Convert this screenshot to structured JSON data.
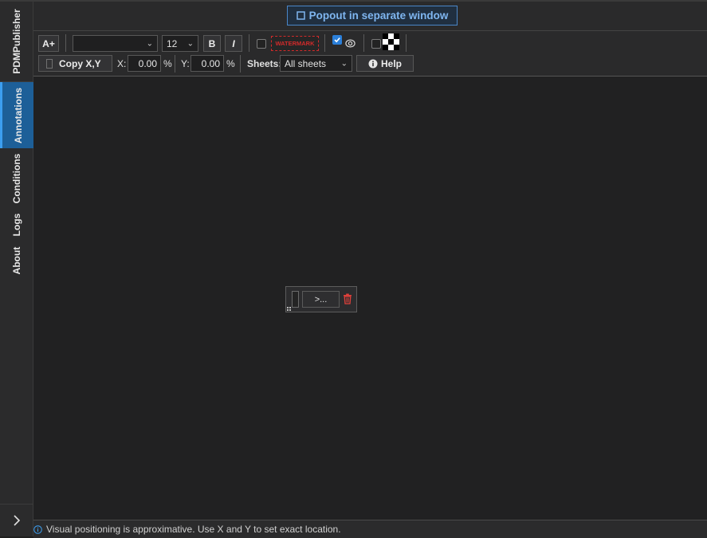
{
  "sidebar": {
    "tabs": [
      {
        "label": "PDMPublisher",
        "active": false
      },
      {
        "label": "Annotations",
        "active": true
      },
      {
        "label": "Conditions",
        "active": false
      },
      {
        "label": "Logs",
        "active": false
      },
      {
        "label": "About",
        "active": false
      }
    ],
    "expand_icon": "chevron-right-icon"
  },
  "toolbar": {
    "popout_label": "Popout in separate window",
    "add_text_label": "A+",
    "font_family_value": "",
    "font_size_value": "12",
    "bold_label": "B",
    "italic_label": "I",
    "watermark_label": "WATERMARK",
    "watermark_checked": false,
    "visible_checked": true,
    "third_checked": false,
    "copy_xy_label": "Copy X,Y",
    "x_label": "X:",
    "x_value": "0.00",
    "x_unit": "%",
    "y_label": "Y:",
    "y_value": "0.00",
    "y_unit": "%",
    "sheets_label": "Sheets:",
    "sheets_value": "All sheets",
    "help_label": "Help"
  },
  "annotation_widget": {
    "text_button_label": ">..."
  },
  "footer": {
    "text": "Visual positioning is approximative. Use X and Y to set exact location."
  },
  "colors": {
    "accent": "#1d5f98",
    "popout_text": "#7fb6f0",
    "watermark_red": "#d12b2b",
    "delete_red": "#e0403a",
    "check_blue": "#2b7fd9"
  }
}
